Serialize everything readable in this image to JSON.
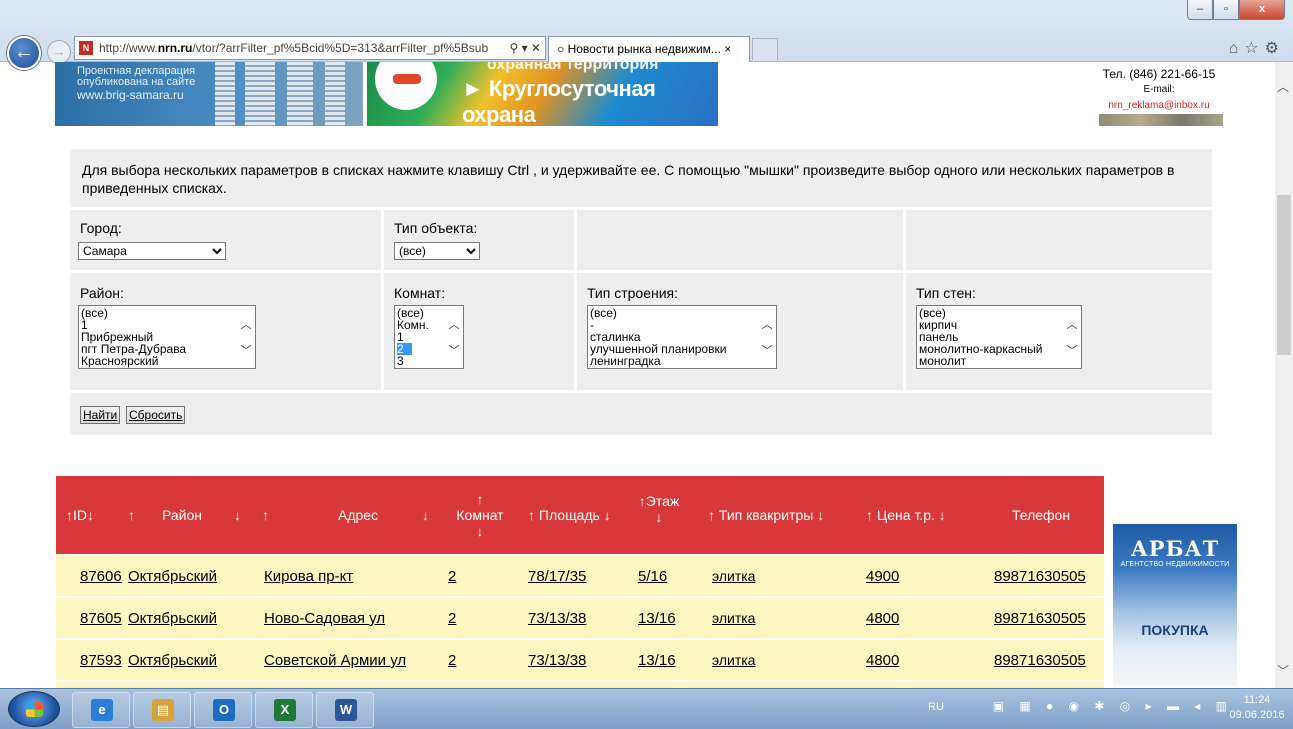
{
  "browser": {
    "address_url_pre": "http://www.",
    "address_url_domain": "nrn.ru",
    "address_url_post": "/vtor/?arrFilter_pf%5Bcid%5D=313&arrFilter_pf%5Bsub",
    "address_tools": "⚲ ▾ ✕",
    "favicon_letter": "N",
    "tab_title": "Новости рынка недвижим...",
    "window_min": "–",
    "window_max": "▫",
    "window_close": "x",
    "back_glyph": "←",
    "fwd_glyph": "→",
    "toolbar_icons": "⌂☆⚙"
  },
  "banner": {
    "left_line1": "Проектная декларация",
    "left_line2": "опубликована на сайте",
    "left_url": "www.brig-samara.ru",
    "mid_top": "охранная территория",
    "mid_slogan": "► Круглосуточная охрана",
    "right_phone": "Тел. (846) 221-66-15",
    "right_email_label": "E-mail: ",
    "right_email": "nrn_reklama@inbox.ru"
  },
  "filter": {
    "help_text": "Для выбора нескольких параметров в списках нажмите клавишу Ctrl , и удерживайте ее. С помощью \"мышки\" произведите выбор одного или нескольких параметров в приведенных списках.",
    "city_label": "Город:",
    "city_value": "Самара",
    "object_type_label": "Тип объекта:",
    "object_type_value": "(все)",
    "district_label": "Район:",
    "district_options": [
      "(все)",
      "1",
      "Прибрежный",
      "пгт Петра-Дубрава",
      "Красноярский"
    ],
    "rooms_label": "Комнат:",
    "rooms_options": [
      "(все)",
      "Комн.",
      "1",
      "2",
      "3"
    ],
    "rooms_selected": "2",
    "building_label": "Тип строения:",
    "building_options": [
      "(все)",
      "-",
      "сталинка",
      "улучшенной планировки",
      "ленинградка"
    ],
    "walls_label": "Тип стен:",
    "walls_options": [
      "(все)",
      "кирпич",
      "панель",
      "монолитно-каркасный",
      "монолит"
    ],
    "find_button": "Найти",
    "reset_button": "Сбросить"
  },
  "table": {
    "headers": {
      "id": "↑ID↓",
      "district_up": "↑",
      "district": "Район",
      "district_down": "↓",
      "address_up": "↑",
      "address": "Адрес",
      "address_down": "↓",
      "rooms_up": "↑",
      "rooms": "Комнат",
      "rooms_down": "↓",
      "area": "↑ Площадь ↓",
      "floor_up": "↑Этаж",
      "floor_down": "↓",
      "flat_type": "↑ Тип квакритры ↓",
      "price": "↑ Цена т.р. ↓",
      "phone": "Телефон"
    },
    "rows": [
      {
        "id": "87606",
        "district": "Октябрьский",
        "address": "Кирова пр-кт",
        "rooms": "2",
        "area": "78/17/35",
        "floor": "5/16",
        "type": "элитка",
        "price": "4900",
        "phone": "89871630505"
      },
      {
        "id": "87605",
        "district": "Октябрьский",
        "address": "Ново-Садовая ул",
        "rooms": "2",
        "area": "73/13/38",
        "floor": "13/16",
        "type": "элитка",
        "price": "4800",
        "phone": "89871630505"
      },
      {
        "id": "87593",
        "district": "Октябрьский",
        "address": "Советской Армии ул",
        "rooms": "2",
        "area": "73/13/38",
        "floor": "13/16",
        "type": "элитка",
        "price": "4800",
        "phone": "89871630505"
      }
    ]
  },
  "ad": {
    "logo": "АРБАТ",
    "subtitle": "АГЕНТСТВО НЕДВИЖИМОСТИ",
    "cta": "ПОКУПКА"
  },
  "taskbar": {
    "lang": "RU",
    "time": "11:24",
    "date": "09.06.2016",
    "apps": [
      {
        "name": "ie",
        "glyph": "e",
        "color": "#2a7fd4"
      },
      {
        "name": "explorer",
        "glyph": "▤",
        "color": "#d6a23a"
      },
      {
        "name": "outlook",
        "glyph": "O",
        "color": "#1e6cc0"
      },
      {
        "name": "excel",
        "glyph": "X",
        "color": "#1f7a3a"
      },
      {
        "name": "word",
        "glyph": "W",
        "color": "#2b5797"
      }
    ],
    "tray_icons": "▣ ▦ ● ◉ ✱ ◎ ▸ ▬ ◂ ▥"
  }
}
